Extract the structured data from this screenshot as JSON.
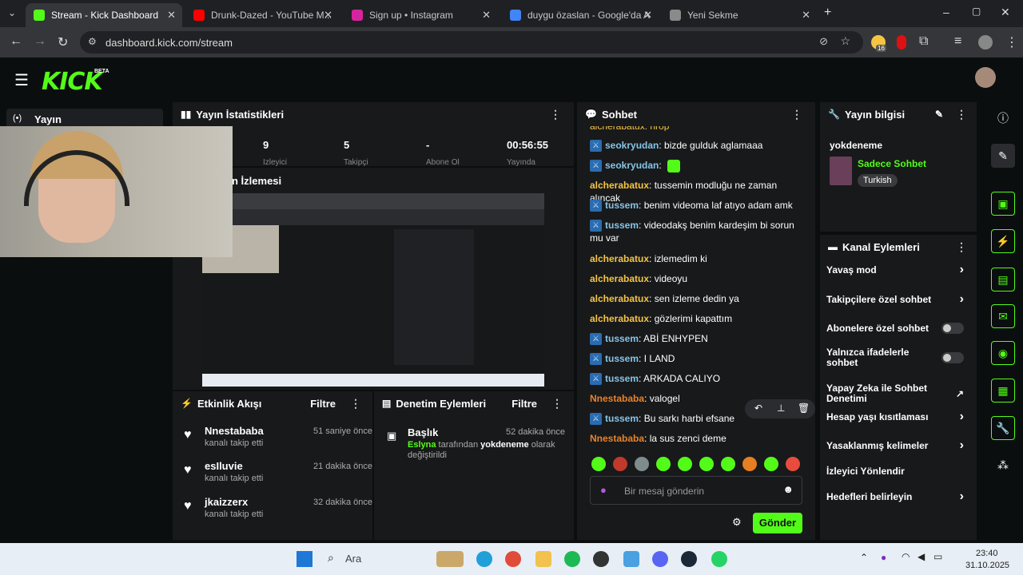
{
  "browser": {
    "tabs": [
      {
        "title": "Stream - Kick Dashboard",
        "color": "#53fc18"
      },
      {
        "title": "Drunk-Dazed - YouTube M...",
        "color": "#ff0000"
      },
      {
        "title": "Sign up • Instagram",
        "color": "#d6249f"
      },
      {
        "title": "duygu özaslan - Google'da Ara",
        "color": "#4285f4"
      },
      {
        "title": "Yeni Sekme",
        "color": "#8a8a8a"
      }
    ],
    "url": "dashboard.kick.com/stream",
    "ext_badge": "16"
  },
  "kick": {
    "logo": "KICK",
    "beta": "BETA",
    "nav_label": "Yayın"
  },
  "stats": {
    "title": "Yayın İstatistikleri",
    "values": [
      "9",
      "5",
      "-",
      "00:56:55"
    ],
    "labels": [
      "İzleyici",
      "Takipçi",
      "Abone Ol",
      "Yayında"
    ]
  },
  "preview": {
    "title": "Yayın İzlemesi",
    "title_visible": "n İzlemesi"
  },
  "activity": {
    "title": "Etkinlik Akışı",
    "filter": "Filtre",
    "items": [
      {
        "name": "Nnestababa",
        "sub": "kanalı takip etti",
        "time": "51 saniye önce"
      },
      {
        "name": "esIluvie",
        "sub": "kanalı takip etti",
        "time": "21 dakika önce"
      },
      {
        "name": "jkaizzerx",
        "sub": "kanalı takip etti",
        "time": "32 dakika önce"
      }
    ]
  },
  "moderation": {
    "title": "Denetim Eylemleri",
    "filter": "Filtre",
    "item": {
      "title": "Başlık",
      "time": "52 dakika önce",
      "user": "Eslyna",
      "mid": " tarafından ",
      "value": "yokdeneme",
      "end": " olarak değiştirildi"
    }
  },
  "chat": {
    "title": "Sohbet",
    "top_partial": "alcherabatux: hrop",
    "messages": [
      {
        "user": "seokryudan",
        "text": "bizde gulduk aglamaaa",
        "badge": true,
        "style": "blue"
      },
      {
        "user": "seokryudan",
        "text": "",
        "badge": true,
        "style": "blue",
        "emote": true
      },
      {
        "user": "alcherabatux",
        "text": "tussemin modluğu ne zaman alıncak",
        "badge": false,
        "style": "yel"
      },
      {
        "user": "tussem",
        "text": "benim videoma laf atıyo adam amk",
        "badge": true,
        "style": "blue"
      },
      {
        "user": "tussem",
        "text": "videodakş benim kardeşim bi sorun mu var",
        "badge": true,
        "style": "blue"
      },
      {
        "user": "alcherabatux",
        "text": "izlemedim ki",
        "badge": false,
        "style": "yel"
      },
      {
        "user": "alcherabatux",
        "text": "videoyu",
        "badge": false,
        "style": "yel"
      },
      {
        "user": "alcherabatux",
        "text": "sen izleme dedin ya",
        "badge": false,
        "style": "yel"
      },
      {
        "user": "alcherabatux",
        "text": "gözlerimi kapattım",
        "badge": false,
        "style": "yel"
      },
      {
        "user": "tussem",
        "text": "ABİ ENHYPEN",
        "badge": true,
        "style": "blue"
      },
      {
        "user": "tussem",
        "text": "I LAND",
        "badge": true,
        "style": "blue"
      },
      {
        "user": "tussem",
        "text": "ARKADA CALIYO",
        "badge": true,
        "style": "blue"
      },
      {
        "user": "Nnestababa",
        "text": "valogel",
        "badge": false,
        "style": "orange"
      },
      {
        "user": "tussem",
        "text": "Bu sarkı harbi efsane",
        "badge": true,
        "style": "blue"
      },
      {
        "user": "Nnestababa",
        "text": "la sus zenci deme",
        "badge": false,
        "style": "orange"
      }
    ],
    "placeholder": "Bir mesaj gönderin",
    "send": "Gönder"
  },
  "streaminfo": {
    "title": "Yayın bilgisi",
    "stream_title": "yokdeneme",
    "category": "Sadece Sohbet",
    "tag": "Turkish"
  },
  "channel_actions": {
    "title": "Kanal Eylemleri",
    "items": [
      {
        "label": "Yavaş mod",
        "control": "chevron"
      },
      {
        "label": "Takipçilere özel sohbet",
        "control": "chevron"
      },
      {
        "label": "Abonelere özel sohbet",
        "control": "toggle"
      },
      {
        "label": "Yalnızca ifadelerle sohbet",
        "control": "toggle"
      },
      {
        "label": "Yapay Zeka ile Sohbet Denetimi",
        "control": "external"
      },
      {
        "label": "Hesap yaşı kısıtlaması",
        "control": "chevron"
      },
      {
        "label": "Yasaklanmış kelimeler",
        "control": "chevron"
      },
      {
        "label": "İzleyici Yönlendir",
        "control": "none"
      },
      {
        "label": "Hedefleri belirleyin",
        "control": "chevron"
      }
    ]
  },
  "taskbar": {
    "search": "Ara",
    "time": "23:40",
    "date": "31.10.2025"
  }
}
